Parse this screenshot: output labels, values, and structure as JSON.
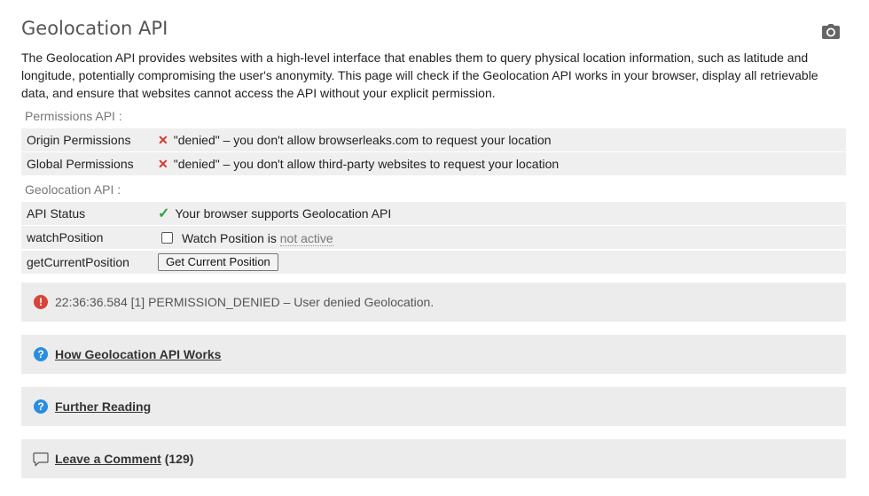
{
  "page": {
    "title": "Geolocation API",
    "intro": "The Geolocation API provides websites with a high-level interface that enables them to query physical location information, such as latitude and longitude, potentially compromising the user's anonymity. This page will check if the Geolocation API works in your browser, display all retrievable data, and ensure that websites cannot access the API without your explicit permission."
  },
  "permissions": {
    "label": "Permissions API :",
    "rows": [
      {
        "key": "Origin Permissions",
        "status": "\"denied\" – you don't allow browserleaks.com to request your location"
      },
      {
        "key": "Global Permissions",
        "status": "\"denied\" – you don't allow third-party websites to request your location"
      }
    ]
  },
  "geolocation": {
    "label": "Geolocation API :",
    "api_status_key": "API Status",
    "api_status_value": "Your browser supports Geolocation API",
    "watch_key": "watchPosition",
    "watch_text": "Watch Position is",
    "watch_state": "not active",
    "getcurrent_key": "getCurrentPosition",
    "getcurrent_button": "Get Current Position"
  },
  "error": {
    "message": "22:36:36.584 [1] PERMISSION_DENIED – User denied Geolocation."
  },
  "panels": {
    "how_works": "How Geolocation API Works",
    "further_reading": "Further Reading",
    "leave_comment": "Leave a Comment",
    "comment_count": "(129)"
  },
  "colors": {
    "denied": "#d9362b",
    "supported": "#2e9e3e",
    "error_icon": "#d9443a",
    "help_icon": "#2a8de0"
  },
  "icons": {
    "camera": "camera-icon",
    "denied": "x-mark-icon",
    "supported": "checkmark-icon",
    "error": "exclamation-circle-icon",
    "help": "question-circle-icon",
    "comment": "speech-bubble-icon"
  }
}
